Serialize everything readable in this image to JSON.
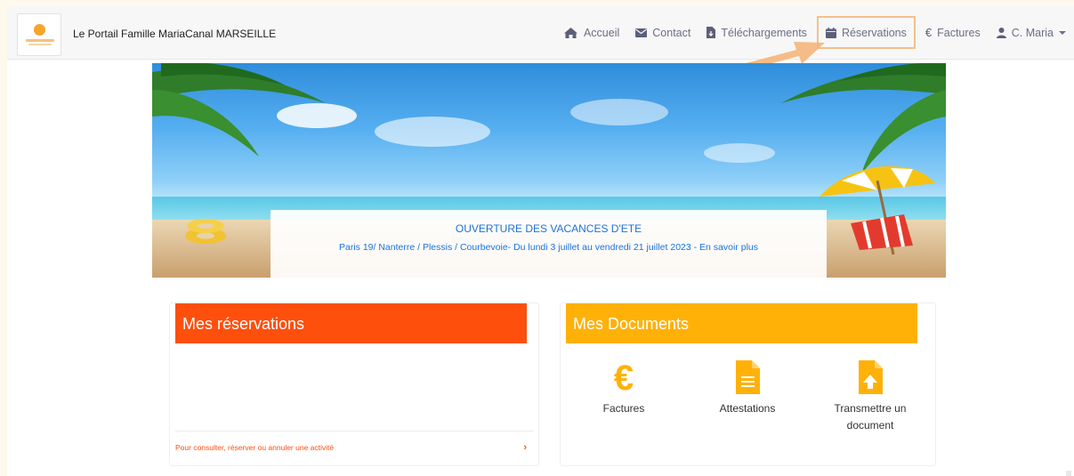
{
  "navbar": {
    "brand": "Le Portail Famille MariaCanal MARSEILLE",
    "items": [
      {
        "label": "Accueil",
        "icon": "home-icon"
      },
      {
        "label": "Contact",
        "icon": "envelope-icon"
      },
      {
        "label": "Téléchargements",
        "icon": "file-download-icon"
      },
      {
        "label": "Réservations",
        "icon": "calendar-icon"
      },
      {
        "label": "Factures",
        "icon": "euro-icon"
      },
      {
        "label": "C. Maria",
        "icon": "user-icon"
      }
    ],
    "active_index": 3,
    "highlight_color": "#f2c08d"
  },
  "banner": {
    "title": "OUVERTURE DES VACANCES D'ETE",
    "subtitle": "Paris 19/ Nanterre / Plessis / Courbevoie- Du lundi 3 juillet au vendredi 21 juillet 2023 - En savoir plus",
    "text_color": "#1a73d9"
  },
  "reservations": {
    "title": "Mes réservations",
    "footer_link": "Pour consulter, réserver ou annuler une activité",
    "accent": "#fe4f0d"
  },
  "documents": {
    "title": "Mes Documents",
    "accent": "#ffb108",
    "items": [
      {
        "label": "Factures",
        "icon": "euro-icon"
      },
      {
        "label": "Attestations",
        "icon": "document-icon"
      },
      {
        "label": "Transmettre un document",
        "icon": "upload-file-icon"
      }
    ]
  }
}
